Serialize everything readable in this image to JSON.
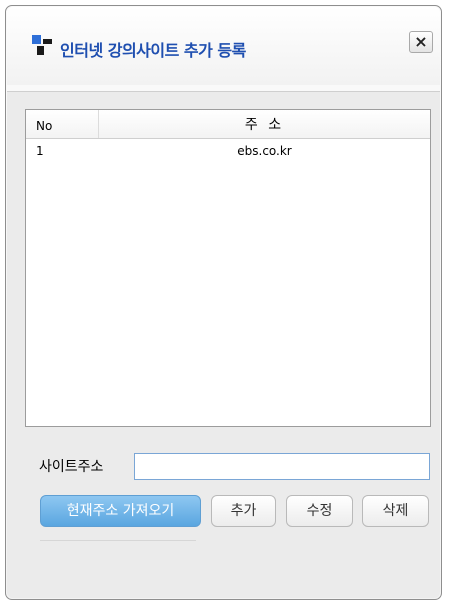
{
  "dialog": {
    "title": "인터넷 강의사이트 추가 등록",
    "close_label": "×"
  },
  "table": {
    "columns": {
      "no": "No",
      "address": "주 소"
    },
    "rows": [
      {
        "no": "1",
        "address": "ebs.co.kr"
      }
    ]
  },
  "form": {
    "site_label": "사이트주소",
    "site_value": ""
  },
  "buttons": {
    "fetch_current": "현재주소 가져오기",
    "add": "추가",
    "edit": "수정",
    "delete": "삭제"
  },
  "colors": {
    "title": "#1f4fb0",
    "primary_button": "#5aa6e0",
    "icon_dark": "#1a1a1a",
    "icon_blue": "#2e6fd8"
  }
}
